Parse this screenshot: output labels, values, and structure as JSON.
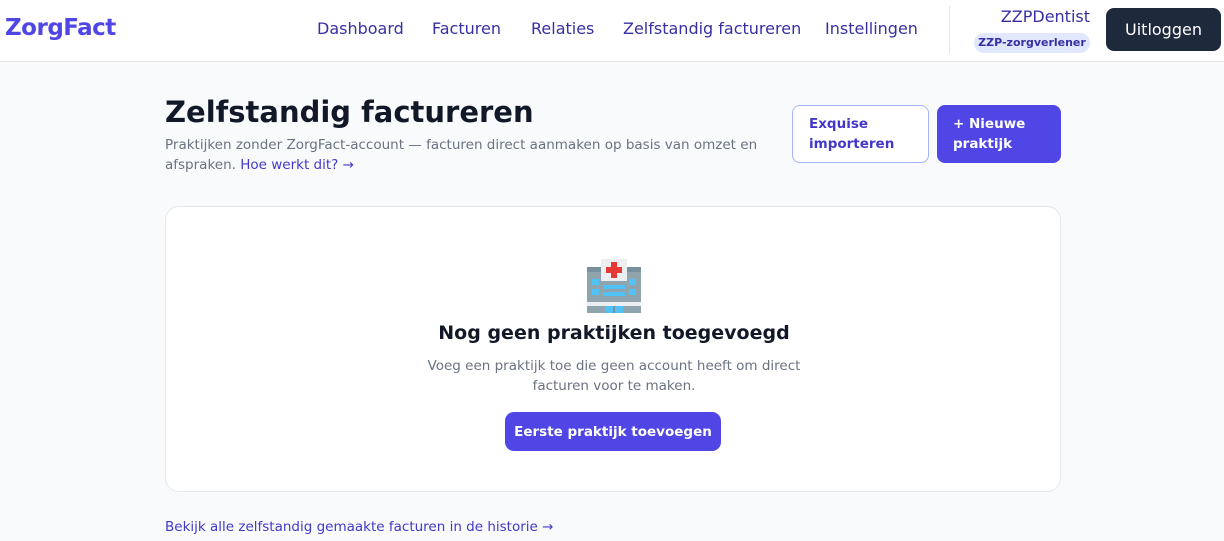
{
  "header": {
    "logo": "ZorgFact",
    "nav": [
      {
        "label": "Dashboard"
      },
      {
        "label": "Facturen"
      },
      {
        "label": "Relaties"
      },
      {
        "label": "Zelfstandig factureren"
      },
      {
        "label": "Instellingen"
      }
    ],
    "user_name": "ZZPDentist",
    "role": "ZZP-zorgverlener",
    "logout_label": "Uitloggen"
  },
  "page": {
    "title": "Zelfstandig factureren",
    "subtitle": "Praktijken zonder ZorgFact-account — facturen direct aanmaken op basis van omzet en afspraken.",
    "help_link": "Hoe werkt dit? →",
    "import_button": "Exquise importeren",
    "new_button": "+ Nieuwe praktijk"
  },
  "empty_state": {
    "icon": "hospital-icon",
    "title": "Nog geen praktijken toegevoegd",
    "text": "Voeg een praktijk toe die geen account heeft om direct facturen voor te maken.",
    "button": "Eerste praktijk toevoegen"
  },
  "footer_link": "Bekijk alle zelfstandig gemaakte facturen in de historie →",
  "colors": {
    "accent": "#4f46e5",
    "nav_text": "#3730a3",
    "dark_button": "#1e293b",
    "badge_bg": "#e0e7ff"
  }
}
